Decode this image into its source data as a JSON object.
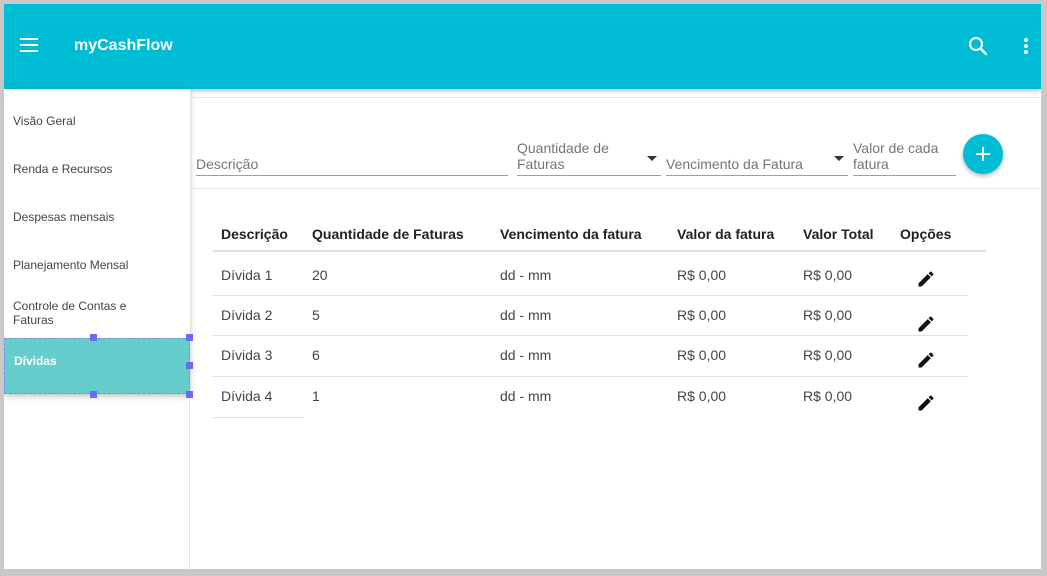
{
  "app": {
    "title": "myCashFlow"
  },
  "sidebar": {
    "items": [
      {
        "label": "Visão Geral"
      },
      {
        "label": "Renda e Recursos"
      },
      {
        "label": "Despesas mensais"
      },
      {
        "label": "Planejamento Mensal"
      },
      {
        "label": "Controle de Contas e Faturas"
      },
      {
        "label": "Dívidas",
        "active": true
      }
    ]
  },
  "form": {
    "descricao_label": "Descrição",
    "quantidade_label": "Quantidade de Faturas",
    "vencimento_label": "Vencimento da Fatura",
    "valor_label": "Valor de cada fatura"
  },
  "table": {
    "headers": [
      "Descrição",
      "Quantidade de Faturas",
      "Vencimento da fatura",
      "Valor da fatura",
      "Valor Total",
      "Opções"
    ],
    "rows": [
      [
        "Dívida 1",
        "20",
        "dd - mm",
        "R$ 0,00",
        "R$ 0,00"
      ],
      [
        "Dívida 2",
        "5",
        "dd - mm",
        "R$ 0,00",
        "R$ 0,00"
      ],
      [
        "Dívida 3",
        "6",
        "dd - mm",
        "R$ 0,00",
        "R$ 0,00"
      ],
      [
        "Dívida 4",
        "1",
        "dd - mm",
        "R$ 0,00",
        "R$ 0,00"
      ]
    ]
  },
  "icons": {
    "menu": "menu-icon",
    "search": "search-icon",
    "more": "more-vert-icon",
    "add": "plus-icon",
    "edit": "pencil-icon"
  },
  "colors": {
    "primary": "#00bcd4",
    "active_nav": "#65cdcc",
    "selection_handle": "#6a6af5"
  }
}
